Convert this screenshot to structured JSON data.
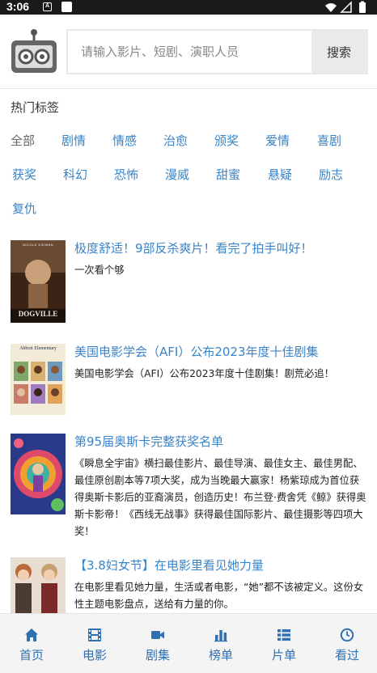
{
  "status_bar": {
    "time": "3:06",
    "notif_a": "A"
  },
  "search": {
    "placeholder": "请输入影片、短剧、演职人员",
    "button_label": "搜索"
  },
  "tags": {
    "title": "热门标签",
    "items": [
      "全部",
      "剧情",
      "情感",
      "治愈",
      "颁奖",
      "爱情",
      "喜剧",
      "获奖",
      "科幻",
      "恐怖",
      "漫威",
      "甜蜜",
      "悬疑",
      "励志",
      "复仇"
    ],
    "active": "全部"
  },
  "articles": [
    {
      "title": "极度舒适！9部反杀爽片！看完了拍手叫好！",
      "desc": "一次看个够",
      "poster_text": "DOGVILLE",
      "poster_top": "NICOLE KIDMAN"
    },
    {
      "title": "美国电影学会（AFI）公布2023年度十佳剧集",
      "desc": "美国电影学会（AFI）公布2023年度十佳剧集！剧荒必追！",
      "poster_text": "Abbott Elementary"
    },
    {
      "title": "第95届奥斯卡完整获奖名单",
      "desc": "《瞬息全宇宙》横扫最佳影片、最佳导演、最佳女主、最佳男配、最佳原创剧本等7项大奖，成为当晚最大赢家！杨紫琼成为首位获得奥斯卡影后的亚裔演员，创造历史！布兰登·费舍凭《鲸》获得奥斯卡影帝！《西线无战事》获得最佳国际影片、最佳摄影等四项大奖！"
    },
    {
      "title": "【3.8妇女节】在电影里看见她力量",
      "desc": "在电影里看见她力量，生活或者电影，“她”都不该被定义。这份女性主题电影盘点，送给有力量的你。"
    }
  ],
  "bottom_nav": {
    "items": [
      {
        "label": "首页",
        "icon": "home-icon"
      },
      {
        "label": "电影",
        "icon": "film-icon"
      },
      {
        "label": "剧集",
        "icon": "video-camera-icon"
      },
      {
        "label": "榜单",
        "icon": "bar-chart-icon"
      },
      {
        "label": "片单",
        "icon": "list-icon"
      },
      {
        "label": "看过",
        "icon": "clock-icon"
      }
    ]
  },
  "colors": {
    "link": "#3a84c9",
    "nav": "#2f6fb3",
    "status_bar": "#1a1a1a"
  }
}
